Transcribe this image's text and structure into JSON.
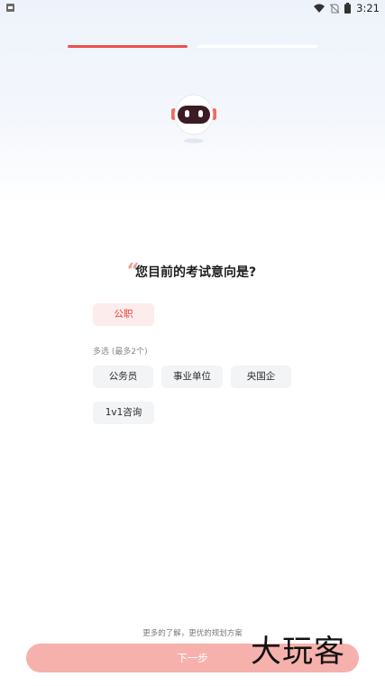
{
  "status_bar": {
    "time": "3:21"
  },
  "progress": {
    "current_step": 1,
    "total_steps": 2
  },
  "question": {
    "quote_mark": "“",
    "text": "您目前的考试意向是?"
  },
  "primary_options": [
    {
      "label": "公职",
      "selected": true
    }
  ],
  "multi_select": {
    "hint": "多选 (最多2个)",
    "options": [
      {
        "label": "公务员",
        "selected": false
      },
      {
        "label": "事业单位",
        "selected": false
      },
      {
        "label": "央国企",
        "selected": false
      },
      {
        "label": "1v1咨询",
        "selected": false
      }
    ]
  },
  "footer": {
    "note": "更多的了解，更优的规划方案",
    "next_label": "下一步"
  },
  "watermark": "大玩客",
  "colors": {
    "accent": "#e8524b",
    "button": "#f6b1ac",
    "chip_bg": "#f3f4f6",
    "selected_bg": "#fdecec"
  }
}
